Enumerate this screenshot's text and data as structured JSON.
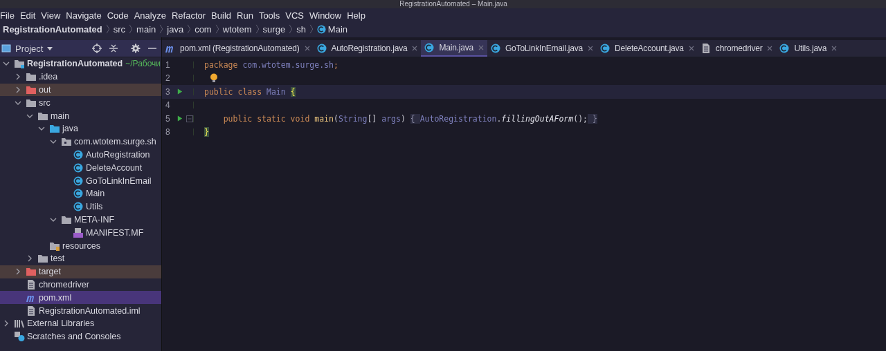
{
  "window": {
    "title": "RegistrationAutomated – Main.java"
  },
  "menu": [
    "File",
    "Edit",
    "View",
    "Navigate",
    "Code",
    "Analyze",
    "Refactor",
    "Build",
    "Run",
    "Tools",
    "VCS",
    "Window",
    "Help"
  ],
  "breadcrumbs": [
    {
      "label": "RegistrationAutomated",
      "kind": "project"
    },
    {
      "label": "src",
      "kind": "dir"
    },
    {
      "label": "main",
      "kind": "dir"
    },
    {
      "label": "java",
      "kind": "dir"
    },
    {
      "label": "com",
      "kind": "dir"
    },
    {
      "label": "wtotem",
      "kind": "dir"
    },
    {
      "label": "surge",
      "kind": "dir"
    },
    {
      "label": "sh",
      "kind": "dir"
    },
    {
      "label": "Main",
      "kind": "class"
    }
  ],
  "project_panel": {
    "title": "Project",
    "tree": [
      {
        "label": "RegistrationAutomated",
        "kind": "module",
        "suffix": "~/Рабочи",
        "expanded": true,
        "selected": false,
        "excluded": false,
        "children": [
          {
            "label": ".idea",
            "kind": "folder",
            "expanded": false,
            "selected": false,
            "excluded": false
          },
          {
            "label": "out",
            "kind": "folder",
            "expanded": false,
            "selected": false,
            "excluded": true
          },
          {
            "label": "src",
            "kind": "folder",
            "expanded": true,
            "selected": false,
            "excluded": false,
            "children": [
              {
                "label": "main",
                "kind": "folder",
                "expanded": true,
                "selected": false,
                "excluded": false,
                "children": [
                  {
                    "label": "java",
                    "kind": "source",
                    "expanded": true,
                    "selected": false,
                    "excluded": false,
                    "children": [
                      {
                        "label": "com.wtotem.surge.sh",
                        "kind": "package",
                        "expanded": true,
                        "selected": false,
                        "excluded": false,
                        "children": [
                          {
                            "label": "AutoRegistration",
                            "kind": "class",
                            "selected": false,
                            "excluded": false
                          },
                          {
                            "label": "DeleteAccount",
                            "kind": "class",
                            "selected": false,
                            "excluded": false
                          },
                          {
                            "label": "GoToLinkInEmail",
                            "kind": "class",
                            "selected": false,
                            "excluded": false
                          },
                          {
                            "label": "Main",
                            "kind": "class",
                            "selected": false,
                            "excluded": false
                          },
                          {
                            "label": "Utils",
                            "kind": "class",
                            "selected": false,
                            "excluded": false
                          }
                        ]
                      },
                      {
                        "label": "META-INF",
                        "kind": "folder",
                        "expanded": true,
                        "selected": false,
                        "excluded": false,
                        "children": [
                          {
                            "label": "MANIFEST.MF",
                            "kind": "manifest",
                            "selected": false,
                            "excluded": false
                          }
                        ]
                      }
                    ]
                  },
                  {
                    "label": "resources",
                    "kind": "resources",
                    "selected": false,
                    "excluded": false
                  }
                ]
              },
              {
                "label": "test",
                "kind": "folder",
                "expanded": false,
                "selected": false,
                "excluded": false
              }
            ]
          },
          {
            "label": "target",
            "kind": "folder",
            "expanded": false,
            "selected": false,
            "excluded": true
          },
          {
            "label": "chromedriver",
            "kind": "file",
            "selected": false,
            "excluded": false
          },
          {
            "label": "pom.xml",
            "kind": "maven",
            "selected": true,
            "excluded": false
          },
          {
            "label": "RegistrationAutomated.iml",
            "kind": "iml",
            "selected": false,
            "excluded": false
          }
        ]
      },
      {
        "label": "External Libraries",
        "kind": "libraries",
        "expanded": false,
        "selected": false,
        "excluded": false
      },
      {
        "label": "Scratches and Consoles",
        "kind": "scratches",
        "selected": false,
        "excluded": false
      }
    ]
  },
  "tabs": [
    {
      "label": "pom.xml (RegistrationAutomated)",
      "kind": "maven",
      "selected": false
    },
    {
      "label": "AutoRegistration.java",
      "kind": "class",
      "selected": false
    },
    {
      "label": "Main.java",
      "kind": "class",
      "selected": true
    },
    {
      "label": "GoToLinkInEmail.java",
      "kind": "class",
      "selected": false
    },
    {
      "label": "DeleteAccount.java",
      "kind": "class",
      "selected": false
    },
    {
      "label": "chromedriver",
      "kind": "file",
      "selected": false
    },
    {
      "label": "Utils.java",
      "kind": "class",
      "selected": false
    }
  ],
  "editor": {
    "lines": [
      {
        "number": "1",
        "run": false,
        "current": false,
        "tokens": [
          {
            "t": "package ",
            "kind": "keyword"
          },
          {
            "t": "com.wtotem.surge.sh",
            "kind": "ident"
          },
          {
            "t": ";",
            "kind": "keyword"
          }
        ]
      },
      {
        "number": "2",
        "run": false,
        "current": false,
        "bulb": true
      },
      {
        "number": "3",
        "run": true,
        "current": true,
        "tokens": [
          {
            "t": "public class ",
            "kind": "keyword"
          },
          {
            "t": "Main ",
            "kind": "ident"
          },
          {
            "t": "{",
            "kind": "brace-match"
          }
        ]
      },
      {
        "number": "4",
        "run": false,
        "current": false
      },
      {
        "number": "5",
        "run": true,
        "current": false,
        "fold": true,
        "tokens": [
          {
            "t": "    public static void ",
            "kind": "keyword"
          },
          {
            "t": "main",
            "kind": "method"
          },
          {
            "t": "(",
            "kind": "plain"
          },
          {
            "t": "String",
            "kind": "ident"
          },
          {
            "t": "[] ",
            "kind": "plain"
          },
          {
            "t": "args",
            "kind": "ident"
          },
          {
            "t": ") ",
            "kind": "plain"
          },
          {
            "t": "{ ",
            "kind": "folded"
          },
          {
            "t": "AutoRegistration",
            "kind": "ident"
          },
          {
            "t": ".",
            "kind": "plain"
          },
          {
            "t": "fillingOutAForm",
            "kind": "static-call"
          },
          {
            "t": "();",
            "kind": "plain"
          },
          {
            "t": " }",
            "kind": "folded"
          }
        ]
      },
      {
        "number": "8",
        "run": false,
        "current": false,
        "tokens": [
          {
            "t": "}",
            "kind": "brace-match"
          }
        ]
      }
    ]
  }
}
